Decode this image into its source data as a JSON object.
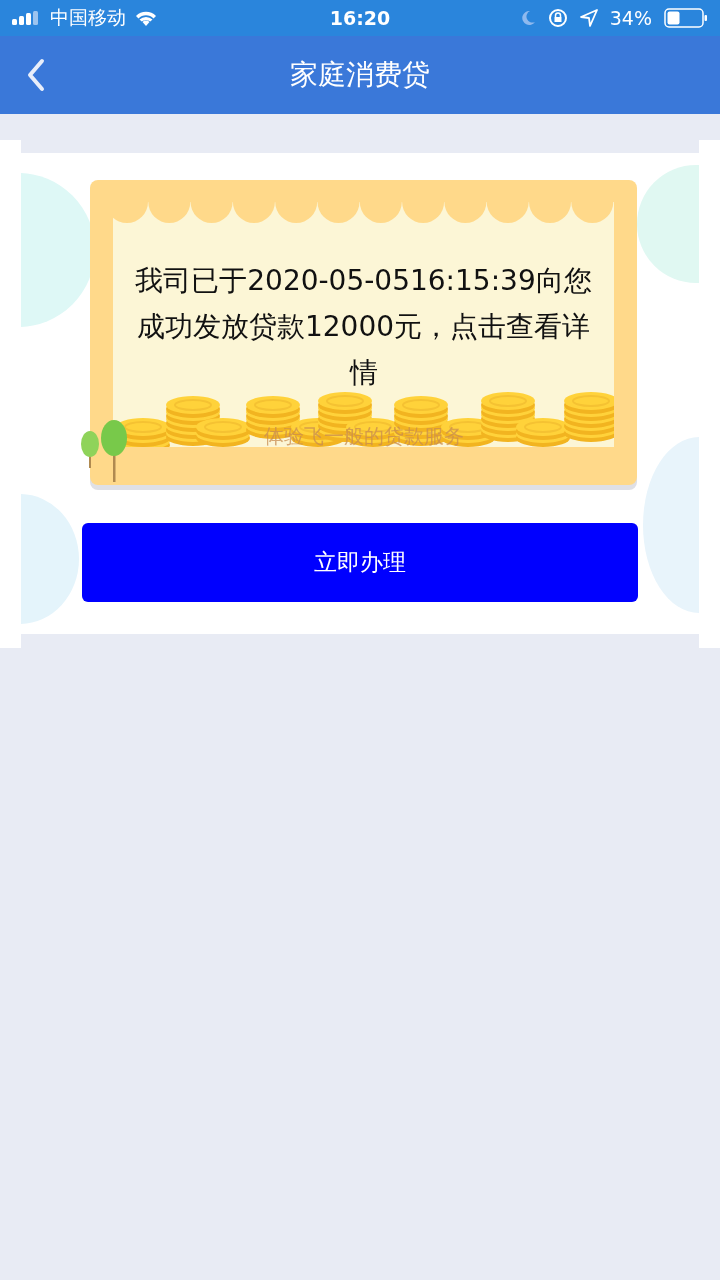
{
  "status_bar": {
    "carrier": "中国移动",
    "time": "16:20",
    "battery": "34%"
  },
  "nav": {
    "title": "家庭消费贷"
  },
  "card": {
    "message": "我司已于2020-05-0516:15:39向您成功发放贷款12000元，点击查看详情",
    "slogan": "体验飞一般的贷款服务"
  },
  "button": {
    "label": "立即办理"
  }
}
